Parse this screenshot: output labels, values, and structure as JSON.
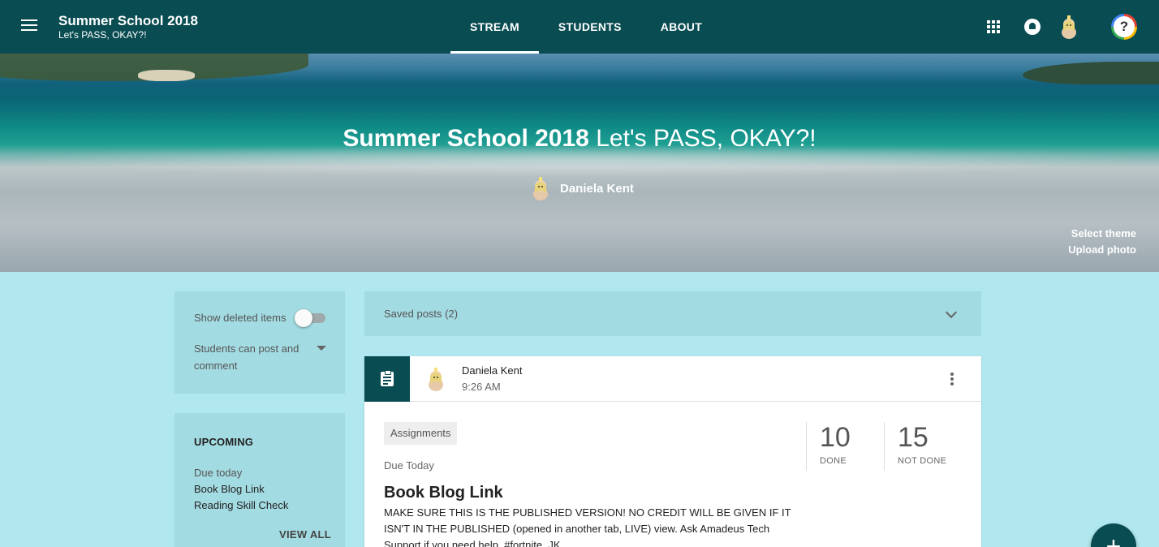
{
  "header": {
    "title": "Summer School 2018",
    "subtitle": "Let's PASS, OKAY?!",
    "tabs": [
      {
        "label": "STREAM",
        "active": true
      },
      {
        "label": "STUDENTS",
        "active": false
      },
      {
        "label": "ABOUT",
        "active": false
      }
    ],
    "help_glyph": "?"
  },
  "banner": {
    "title": "Summer School 2018",
    "section": "Let's PASS, OKAY?!",
    "teacher": "Daniela Kent",
    "select_theme": "Select theme",
    "upload_photo": "Upload photo"
  },
  "settings": {
    "show_deleted_label": "Show deleted items",
    "show_deleted_on": false,
    "post_permission": "Students can post and comment"
  },
  "upcoming": {
    "title": "UPCOMING",
    "due_label": "Due today",
    "items": [
      "Book Blog Link",
      "Reading Skill Check"
    ],
    "view_all": "VIEW ALL"
  },
  "stream": {
    "saved_posts": "Saved posts (2)",
    "post": {
      "author": "Daniela Kent",
      "time": "9:26 AM",
      "topic": "Assignments",
      "due": "Due Today",
      "title": "Book Blog Link",
      "description": "MAKE SURE THIS IS THE PUBLISHED VERSION! NO CREDIT WILL BE GIVEN IF IT ISN'T IN THE PUBLISHED (opened in another tab, LIVE) view. Ask Amadeus Tech Support if you need help. #fortnite. JK.",
      "done_count": "10",
      "done_label": "DONE",
      "not_done_count": "15",
      "not_done_label": "NOT DONE"
    }
  },
  "fab": {
    "glyph": "+"
  },
  "colors": {
    "brand": "#094c52",
    "page_bg": "#b1e7ee",
    "card_bg": "#a3dbe2"
  },
  "icons": [
    "menu-icon",
    "apps-icon",
    "notifications-icon",
    "avatar",
    "help-icon",
    "assignment-icon",
    "more-vert-icon",
    "chevron-down-icon",
    "dropdown-caret-icon",
    "add-icon"
  ]
}
